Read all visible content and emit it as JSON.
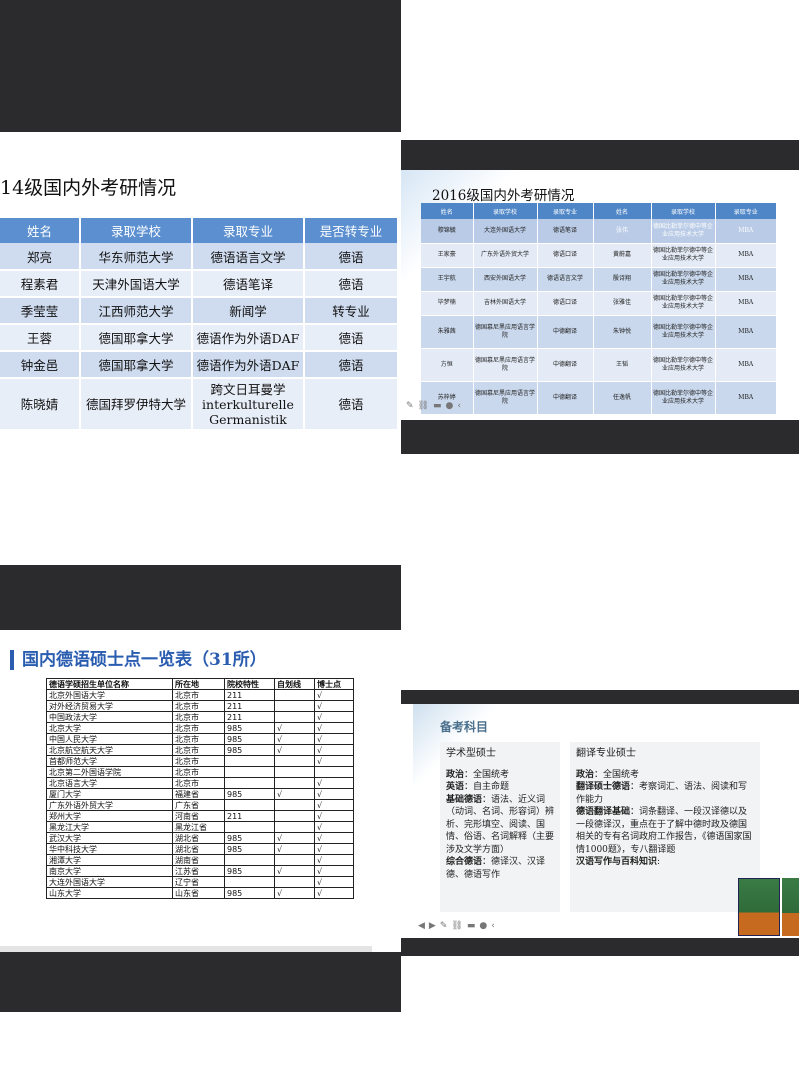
{
  "q1": {
    "title": "14级国内外考研情况",
    "headers": [
      "姓名",
      "录取学校",
      "录取专业",
      "是否转专业"
    ],
    "rows": [
      [
        "郑亮",
        "华东师范大学",
        "德语语言文学",
        "德语"
      ],
      [
        "程素君",
        "天津外国语大学",
        "德语笔译",
        "德语"
      ],
      [
        "季莹莹",
        "江西师范大学",
        "新闻学",
        "转专业"
      ],
      [
        "王蓉",
        "德国耶拿大学",
        "德语作为外语DAF",
        "德语"
      ],
      [
        "钟金邑",
        "德国耶拿大学",
        "德语作为外语DAF",
        "德语"
      ]
    ],
    "last_row": {
      "name": "陈晓婧",
      "school": "德国拜罗伊特大学",
      "major_1": "跨文日耳曼学",
      "major_2": "interkulturelle",
      "major_3": "Germanistik",
      "switch": "德语"
    }
  },
  "q2": {
    "title": "2016级国内外考研情况",
    "headers": [
      "姓名",
      "录取学校",
      "录取专业",
      "姓名",
      "录取学校",
      "录取专业"
    ],
    "rows": [
      [
        "穆锦毓",
        "大连外国语大学",
        "德语笔译",
        "张伟",
        "德国比勒菲尔德中等企业应用技术大学",
        "MBA"
      ],
      [
        "王家豪",
        "广东外语外贸大学",
        "德语口译",
        "黄蔚嘉",
        "德国比勒菲尔德中等企业应用技术大学",
        "MBA"
      ],
      [
        "王宇航",
        "西安外国语大学",
        "德语语言文学",
        "殷诗翔",
        "德国比勒菲尔德中等企业应用技术大学",
        "MBA"
      ],
      [
        "毕梦楠",
        "吉林外国语大学",
        "德语口译",
        "张雅佳",
        "德国比勒菲尔德中等企业应用技术大学",
        "MBA"
      ],
      [
        "朱雅茜",
        "德国慕尼黑应用语言学院",
        "中德翻译",
        "朱钟悦",
        "德国比勒菲尔德中等企业应用技术大学",
        "MBA"
      ],
      [
        "方恒",
        "德国慕尼黑应用语言学院",
        "中德翻译",
        "王韬",
        "德国比勒菲尔德中等企业应用技术大学",
        "MBA"
      ],
      [
        "苏梓婷",
        "德国慕尼黑应用语言学院",
        "中德翻译",
        "任逸帆",
        "德国比勒菲尔德中等企业应用技术大学",
        "MBA"
      ]
    ]
  },
  "q3": {
    "title": "国内德语硕士点一览表（31所）",
    "headers": [
      "德语学硕招生单位名称",
      "所在地",
      "院校特性",
      "自划线",
      "博士点"
    ],
    "rows": [
      [
        "北京外国语大学",
        "北京市",
        "211",
        "",
        "√"
      ],
      [
        "对外经济贸易大学",
        "北京市",
        "211",
        "",
        "√"
      ],
      [
        "中国政法大学",
        "北京市",
        "211",
        "",
        "√"
      ],
      [
        "北京大学",
        "北京市",
        "985",
        "√",
        "√"
      ],
      [
        "中国人民大学",
        "北京市",
        "985",
        "√",
        "√"
      ],
      [
        "北京航空航天大学",
        "北京市",
        "985",
        "√",
        "√"
      ],
      [
        "首都师范大学",
        "北京市",
        "",
        "",
        "√"
      ],
      [
        "北京第二外国语学院",
        "北京市",
        "",
        "",
        ""
      ],
      [
        "北京语言大学",
        "北京市",
        "",
        "",
        "√"
      ],
      [
        "厦门大学",
        "福建省",
        "985",
        "√",
        "√"
      ],
      [
        "广东外语外贸大学",
        "广东省",
        "",
        "",
        "√"
      ],
      [
        "郑州大学",
        "河南省",
        "211",
        "",
        "√"
      ],
      [
        "黑龙江大学",
        "黑龙江省",
        "",
        "",
        "√"
      ],
      [
        "武汉大学",
        "湖北省",
        "985",
        "√",
        "√"
      ],
      [
        "华中科技大学",
        "湖北省",
        "985",
        "√",
        "√"
      ],
      [
        "湘潭大学",
        "湖南省",
        "",
        "",
        "√"
      ],
      [
        "南京大学",
        "江苏省",
        "985",
        "√",
        "√"
      ],
      [
        "大连外国语大学",
        "辽宁省",
        "",
        "",
        "√"
      ],
      [
        "山东大学",
        "山东省",
        "985",
        "√",
        "√"
      ]
    ]
  },
  "q4": {
    "heading": "备考科目",
    "left": {
      "title": "学术型硕士",
      "l1_b": "政治",
      "l1": "：全国统考",
      "l2_b": "英语",
      "l2": "：自主命题",
      "l3_b": "基础德语",
      "l3": "：语法、近义词（动词、名词、形容词）辨析、完形填空、阅读、国情、俗语、名词解释（主要涉及文学方面）",
      "l4_b": "综合德语",
      "l4": "：德译汉、汉译德、德语写作"
    },
    "right": {
      "title": "翻译专业硕士",
      "r1_b": "政治",
      "r1": "：全国统考",
      "r2_b": "翻译硕士德语",
      "r2": "：考察词汇、语法、阅读和写作能力",
      "r3_b": "德语翻译基础",
      "r3": "：词条翻译、一段汉译德以及一段德译汉，重点在于了解中德时政及德国相关的专有名词政府工作报告，《德语国家国情1000题》，专八翻译题",
      "r4_b": "汉语写作与百科知识",
      "r4": ":"
    },
    "book_title": "德语国家国情1000题"
  }
}
